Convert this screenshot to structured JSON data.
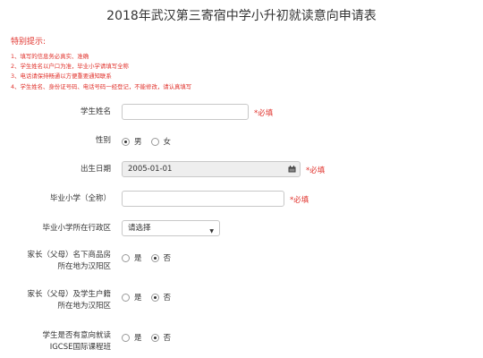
{
  "title": "2018年武汉第三寄宿中学小升初就读意向申请表",
  "tips": {
    "heading": "特别提示:",
    "items": [
      "1、填写的信息务必真实、准确",
      "2、学生姓名以户口为准，毕业小学请填写全称",
      "3、电话请保持畅通以方便重要通知联系",
      "4、学生姓名、身份证号码、电话号码一经登记，不能修改，请认真填写"
    ]
  },
  "form": {
    "name_label": "学生姓名",
    "name_value": "",
    "required_text": "*必填",
    "gender_label": "性别",
    "gender_options": [
      "男",
      "女"
    ],
    "gender_selected": "男",
    "dob_label": "出生日期",
    "dob_value": "2005-01-01",
    "school_label": "毕业小学（全称）",
    "school_value": "",
    "district_label": "毕业小学所在行政区",
    "district_value": "请选择",
    "property_label_line1": "家长（父母）名下商品房",
    "property_label_line2": "所在地为汉阳区",
    "property_options": [
      "是",
      "否"
    ],
    "property_selected": "否",
    "hukou_label_line1": "家长（父母）及学生户籍",
    "hukou_label_line2": "所在地为汉阳区",
    "hukou_options": [
      "是",
      "否"
    ],
    "hukou_selected": "否",
    "igcse_label_line1": "学生是否有意向就读",
    "igcse_label_line2": "IGCSE国际课程班",
    "igcse_options": [
      "是",
      "否"
    ],
    "igcse_selected": "否"
  },
  "icons": {
    "calendar": "calendar-icon",
    "dropdown": "caret-down-icon"
  },
  "colors": {
    "required": "#e0302a",
    "text": "#333333",
    "disabled_bg": "#eeeeee"
  }
}
